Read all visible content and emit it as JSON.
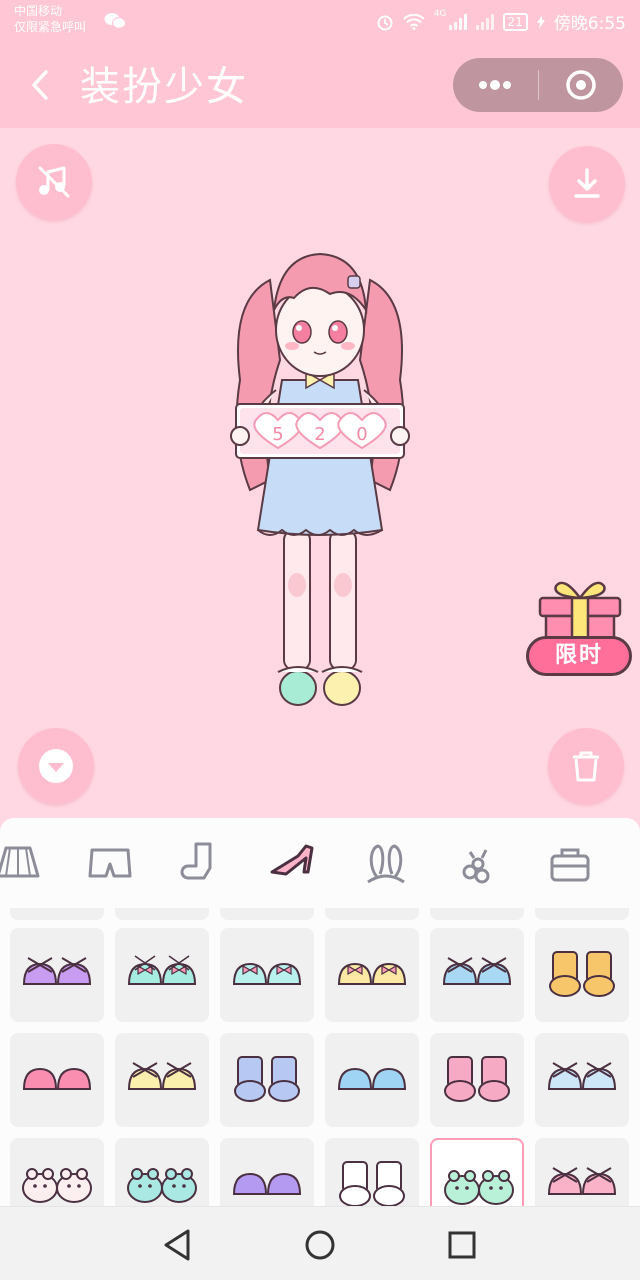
{
  "status_bar": {
    "carrier_line1": "中国移动",
    "carrier_line2": "仅限紧急呼叫",
    "network_badge": "4G",
    "battery": "21",
    "time": "傍晚6:55"
  },
  "nav": {
    "title": "装扮少女"
  },
  "doll": {
    "sign_digits": [
      "5",
      "2",
      "0"
    ]
  },
  "gift": {
    "label": "限时"
  },
  "categories": [
    {
      "icon": "skirt-icon",
      "selected": false
    },
    {
      "icon": "shorts-icon",
      "selected": false
    },
    {
      "icon": "sock-icon",
      "selected": false
    },
    {
      "icon": "high-heel-icon",
      "selected": true
    },
    {
      "icon": "bunny-ears-icon",
      "selected": false
    },
    {
      "icon": "flower-accessory-icon",
      "selected": false
    },
    {
      "icon": "bag-icon",
      "selected": false
    },
    {
      "icon": "balloon-icon",
      "selected": false
    }
  ],
  "items": [
    {
      "icon": "purple-strap-shoes-icon",
      "color": "#c89cf0",
      "style": "strap",
      "selected": false
    },
    {
      "icon": "mint-ribbon-shoes-icon",
      "color": "#a7ece0",
      "style": "ribbon",
      "selected": false
    },
    {
      "icon": "mint-bow-shoes-icon",
      "color": "#b9f1ec",
      "style": "bow",
      "selected": false
    },
    {
      "icon": "yellow-bow-shoes-icon",
      "color": "#fbe9a3",
      "style": "bow",
      "selected": false
    },
    {
      "icon": "blue-heart-shoes-icon",
      "color": "#a9d8f4",
      "style": "strap",
      "selected": false
    },
    {
      "icon": "orange-boots-icon",
      "color": "#f7c56a",
      "style": "boot",
      "selected": false
    },
    {
      "icon": "pink-flats-icon",
      "color": "#f98eb0",
      "style": "flat",
      "selected": false
    },
    {
      "icon": "yellow-mary-janes-icon",
      "color": "#fbefae",
      "style": "strap",
      "selected": false
    },
    {
      "icon": "blue-laced-boots-icon",
      "color": "#b7c8f2",
      "style": "boot",
      "selected": false
    },
    {
      "icon": "sky-blue-loafers-icon",
      "color": "#9fd4f5",
      "style": "flat",
      "selected": false
    },
    {
      "icon": "pink-bow-boots-icon",
      "color": "#f7aac3",
      "style": "boot",
      "selected": false
    },
    {
      "icon": "light-blue-sandals-icon",
      "color": "#cde6f8",
      "style": "strap",
      "selected": false
    },
    {
      "icon": "bear-slippers-icon",
      "color": "#fdeef0",
      "style": "animal",
      "selected": false
    },
    {
      "icon": "bunny-slippers-icon",
      "color": "#a9e8e3",
      "style": "animal",
      "selected": false
    },
    {
      "icon": "purple-rounded-shoes-icon",
      "color": "#b59af2",
      "style": "flat",
      "selected": false
    },
    {
      "icon": "white-socks-icon",
      "color": "#ffffff",
      "style": "boot",
      "selected": false
    },
    {
      "icon": "mint-yellow-fluffy-slippers-icon",
      "color": "#b8f0d8",
      "style": "animal",
      "selected": true
    },
    {
      "icon": "pink-star-shoes-icon",
      "color": "#f9b2c8",
      "style": "strap",
      "selected": false
    }
  ],
  "colors": {
    "header": "#ffc6d6",
    "background": "#ffd8e3",
    "button": "#ffbdd0",
    "capsule": "#bf969f",
    "gift_tag": "#ff6f9a"
  }
}
